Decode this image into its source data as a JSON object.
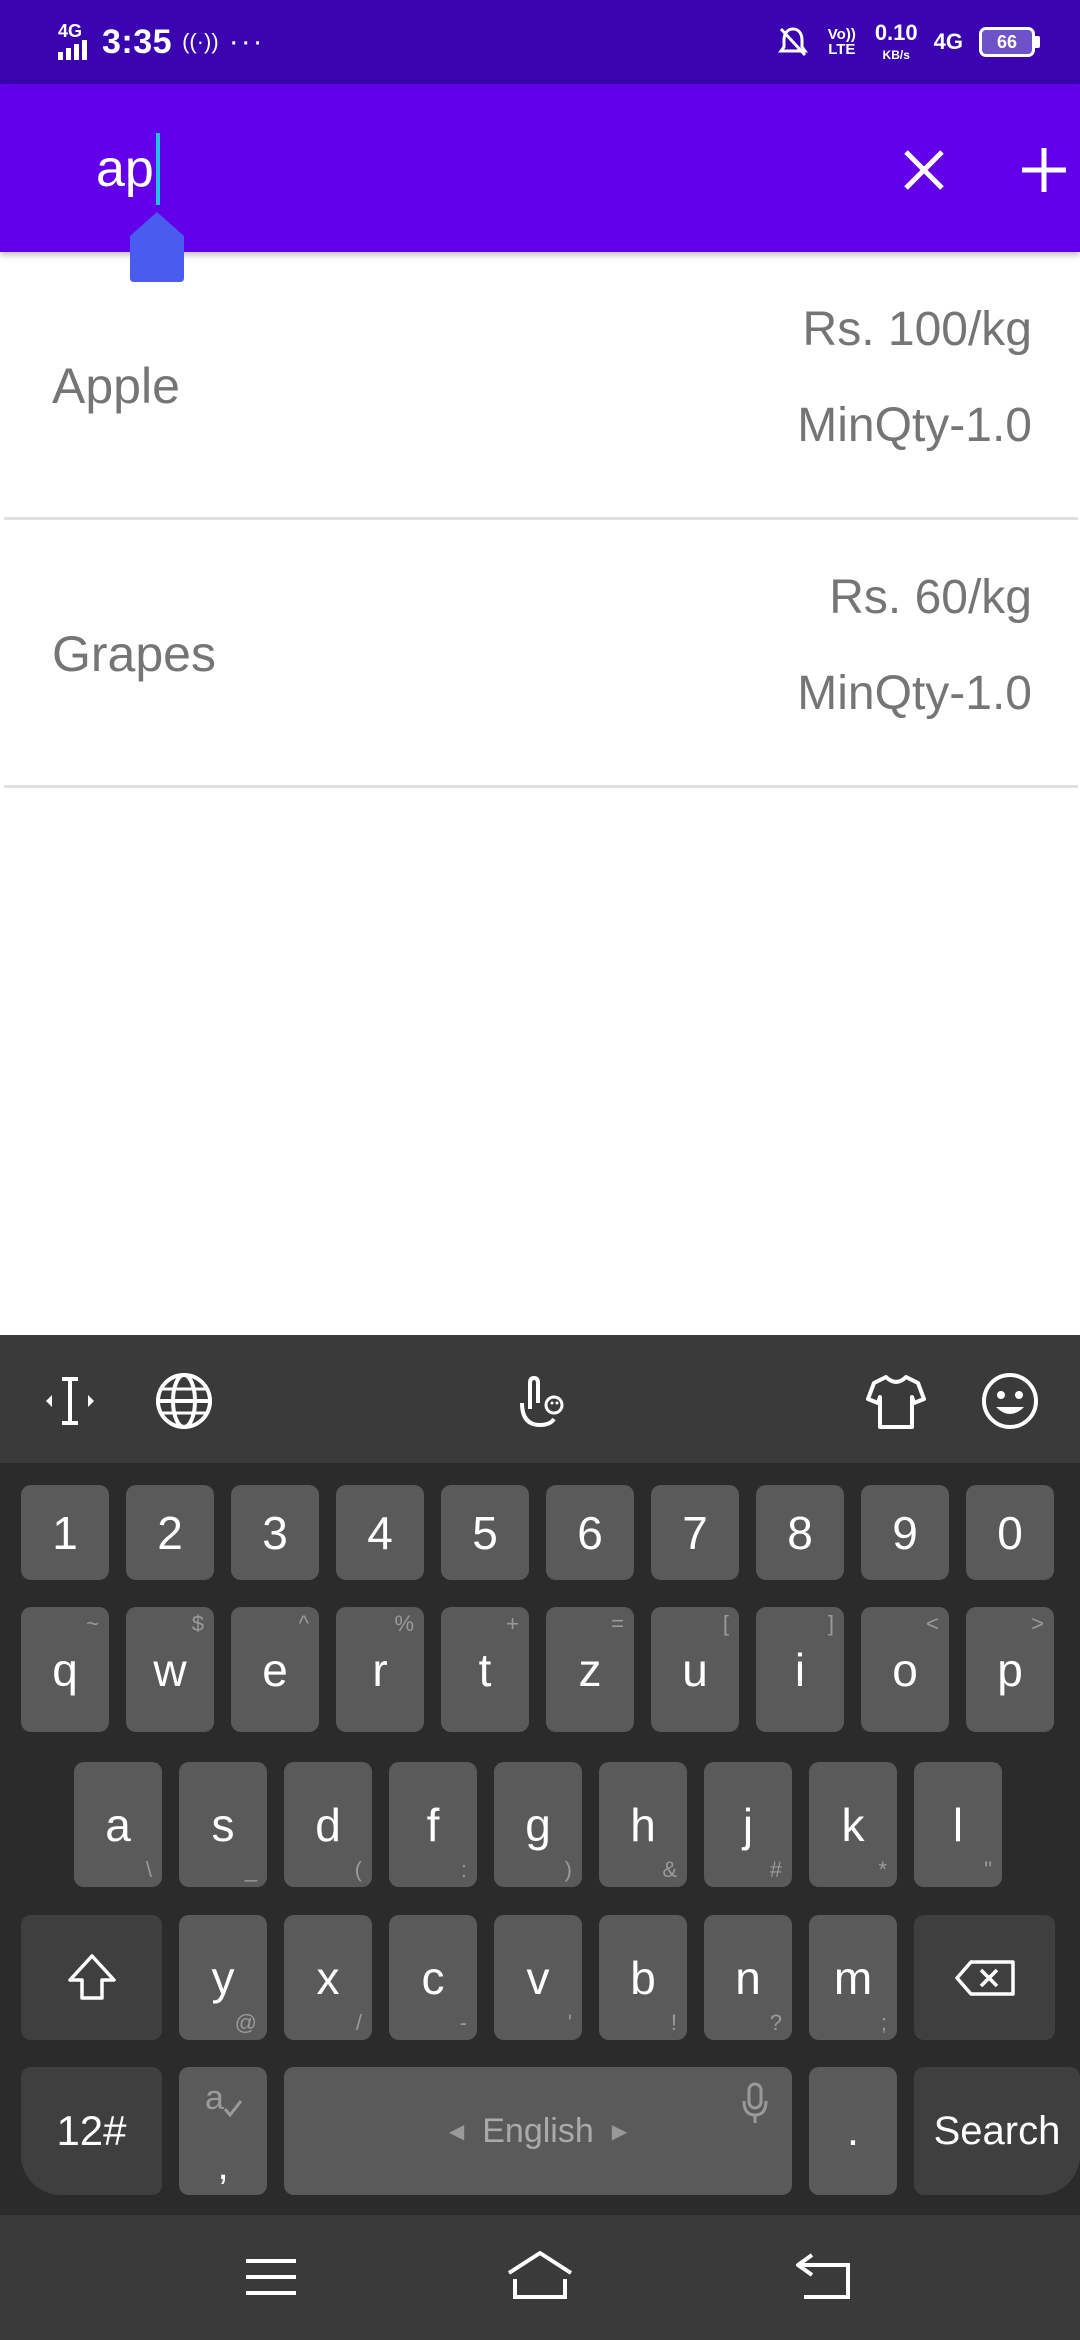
{
  "status_bar": {
    "network_label": "4G",
    "time": "3:35",
    "hotspot": "((·))",
    "more": "···",
    "volte": "Vo)) LTE",
    "speed_value": "0.10",
    "speed_unit": "KB/s",
    "network_right": "4G",
    "battery": "66"
  },
  "search": {
    "query": "ap"
  },
  "products": [
    {
      "name": "Apple",
      "price": "Rs. 100/kg",
      "min_qty": "MinQty-1.0"
    },
    {
      "name": "Grapes",
      "price": "Rs. 60/kg",
      "min_qty": "MinQty-1.0"
    }
  ],
  "keyboard": {
    "number_row": [
      "1",
      "2",
      "3",
      "4",
      "5",
      "6",
      "7",
      "8",
      "9",
      "0"
    ],
    "row1": [
      {
        "k": "q",
        "s": "~"
      },
      {
        "k": "w",
        "s": "$"
      },
      {
        "k": "e",
        "s": "^"
      },
      {
        "k": "r",
        "s": "%"
      },
      {
        "k": "t",
        "s": "+"
      },
      {
        "k": "z",
        "s": "="
      },
      {
        "k": "u",
        "s": "["
      },
      {
        "k": "i",
        "s": "]"
      },
      {
        "k": "o",
        "s": "<"
      },
      {
        "k": "p",
        "s": ">"
      }
    ],
    "row2": [
      {
        "k": "a",
        "s": "\\"
      },
      {
        "k": "s",
        "s": "_"
      },
      {
        "k": "d",
        "s": "("
      },
      {
        "k": "f",
        "s": ":"
      },
      {
        "k": "g",
        "s": ")"
      },
      {
        "k": "h",
        "s": "&"
      },
      {
        "k": "j",
        "s": "#"
      },
      {
        "k": "k",
        "s": "*"
      },
      {
        "k": "l",
        "s": "\""
      }
    ],
    "row3": [
      {
        "k": "y",
        "s": "@"
      },
      {
        "k": "x",
        "s": "/"
      },
      {
        "k": "c",
        "s": "-"
      },
      {
        "k": "v",
        "s": "'"
      },
      {
        "k": "b",
        "s": "!"
      },
      {
        "k": "n",
        "s": "?"
      },
      {
        "k": "m",
        "s": ";"
      }
    ],
    "symbols_label": "12#",
    "comma_label": ",",
    "language": "English",
    "period_label": ".",
    "action_label": "Search"
  },
  "colors": {
    "status_bar": "#3a05b0",
    "app_bar": "#6200ea",
    "cursor": "#22c0e8",
    "handle": "#4a5bf0"
  }
}
